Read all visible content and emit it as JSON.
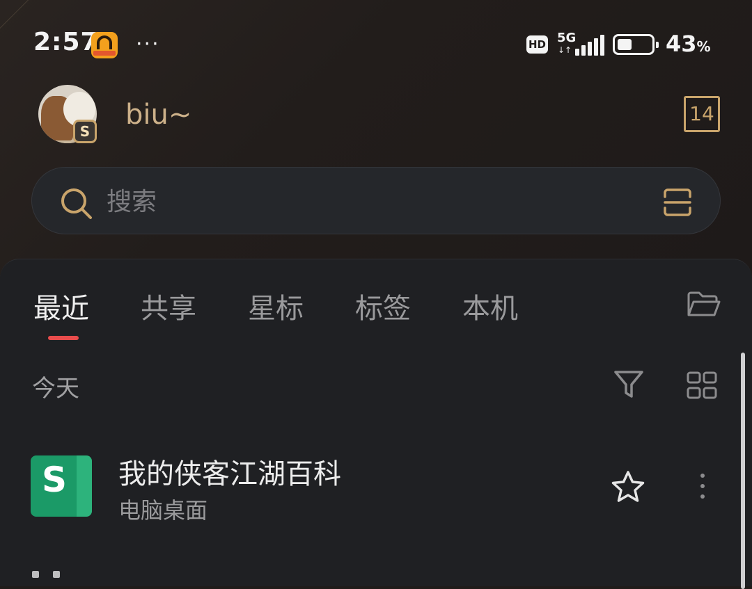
{
  "status_bar": {
    "time": "2:57",
    "more_dots": "···",
    "hd_label": "HD",
    "network_label": "5G",
    "data_arrows": "↓↑",
    "battery_percent": 43,
    "battery_number": "43",
    "battery_unit": "%"
  },
  "profile": {
    "username": "biu~",
    "badge_letter": "S",
    "calendar_day": "14"
  },
  "search": {
    "placeholder": "搜索",
    "value": ""
  },
  "tabs": [
    {
      "label": "最近",
      "active": true
    },
    {
      "label": "共享",
      "active": false
    },
    {
      "label": "星标",
      "active": false
    },
    {
      "label": "标签",
      "active": false
    },
    {
      "label": "本机",
      "active": false
    }
  ],
  "section": {
    "header": "今天"
  },
  "files": [
    {
      "icon_letter": "S",
      "title": "我的侠客江湖百科",
      "location": "电脑桌面",
      "starred": false
    }
  ],
  "colors": {
    "accent_gold": "#c9a46b",
    "tab_indicator": "#e84c4c",
    "sheet_green": "#1b9a67",
    "panel_bg": "#1f2023"
  }
}
